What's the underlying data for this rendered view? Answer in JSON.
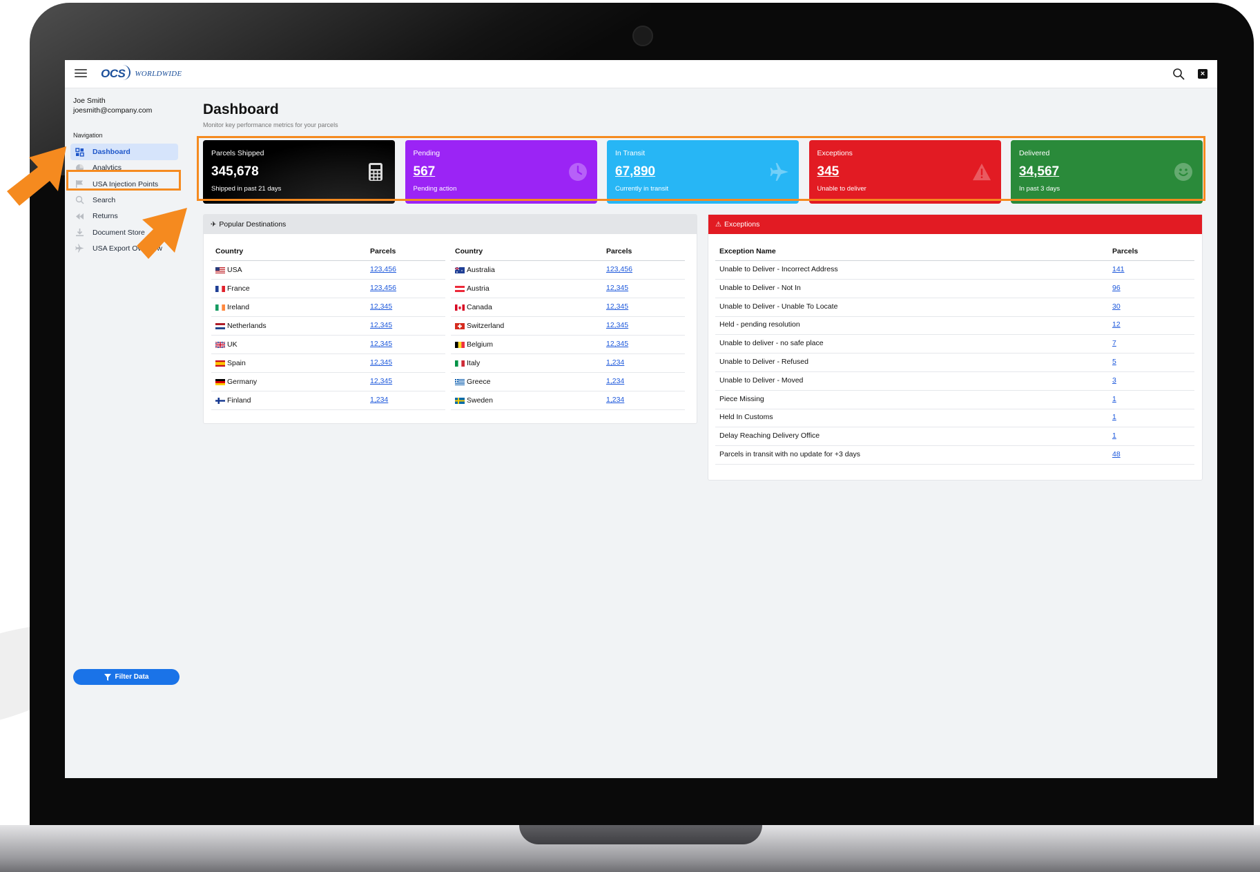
{
  "header": {
    "logo_mark": "OCS",
    "logo_word": "WORLDWIDE",
    "close_label": "×"
  },
  "user": {
    "name": "Joe Smith",
    "email": "joesmith@company.com"
  },
  "navigation": {
    "title": "Navigation",
    "items": [
      {
        "label": "Dashboard",
        "icon": "grid-icon",
        "active": true
      },
      {
        "label": "Analytics",
        "icon": "pie-chart-icon"
      },
      {
        "label": "USA Injection Points",
        "icon": "flag-icon"
      },
      {
        "label": "Search",
        "icon": "search-icon"
      },
      {
        "label": "Returns",
        "icon": "rewind-icon"
      },
      {
        "label": "Document Store",
        "icon": "download-icon"
      },
      {
        "label": "USA Export Overview",
        "icon": "plane-icon"
      }
    ],
    "filter_label": "Filter Data"
  },
  "page": {
    "title": "Dashboard",
    "subtitle": "Monitor key performance metrics for your parcels"
  },
  "cards": [
    {
      "label": "Parcels Shipped",
      "value": "345,678",
      "sub": "Shipped in past 21 days",
      "color": "#111111",
      "icon": "calculator-icon"
    },
    {
      "label": "Pending",
      "value": "567",
      "sub": "Pending action",
      "color": "#9b24f5",
      "icon": "clock-icon"
    },
    {
      "label": "In Transit",
      "value": "67,890",
      "sub": "Currently in transit",
      "color": "#27b6f5",
      "icon": "plane-icon"
    },
    {
      "label": "Exceptions",
      "value": "345",
      "sub": "Unable to deliver",
      "color": "#e21b23",
      "icon": "warning-icon"
    },
    {
      "label": "Delivered",
      "value": "34,567",
      "sub": "In past 3 days",
      "color": "#2a8a3a",
      "icon": "smiley-icon"
    }
  ],
  "destinations": {
    "title": "Popular Destinations",
    "headers": {
      "country": "Country",
      "parcels": "Parcels"
    },
    "left": [
      {
        "country": "USA",
        "parcels": "123,456",
        "flag": "usa"
      },
      {
        "country": "France",
        "parcels": "123,456",
        "flag": "france"
      },
      {
        "country": "Ireland",
        "parcels": "12,345",
        "flag": "ireland"
      },
      {
        "country": "Netherlands",
        "parcels": "12,345",
        "flag": "netherlands"
      },
      {
        "country": "UK",
        "parcels": "12,345",
        "flag": "uk"
      },
      {
        "country": "Spain",
        "parcels": "12,345",
        "flag": "spain"
      },
      {
        "country": "Germany",
        "parcels": "12,345",
        "flag": "germany"
      },
      {
        "country": "Finland",
        "parcels": "1,234",
        "flag": "finland"
      }
    ],
    "right": [
      {
        "country": "Australia",
        "parcels": "123,456",
        "flag": "australia"
      },
      {
        "country": "Austria",
        "parcels": "12,345",
        "flag": "austria"
      },
      {
        "country": "Canada",
        "parcels": "12,345",
        "flag": "canada"
      },
      {
        "country": "Switzerland",
        "parcels": "12,345",
        "flag": "switzerland"
      },
      {
        "country": "Belgium",
        "parcels": "12,345",
        "flag": "belgium"
      },
      {
        "country": "Italy",
        "parcels": "1,234",
        "flag": "italy"
      },
      {
        "country": "Greece",
        "parcels": "1,234",
        "flag": "greece"
      },
      {
        "country": "Sweden",
        "parcels": "1,234",
        "flag": "sweden"
      }
    ]
  },
  "exceptions": {
    "title": "Exceptions",
    "headers": {
      "name": "Exception Name",
      "parcels": "Parcels"
    },
    "rows": [
      {
        "name": "Unable to Deliver - Incorrect Address",
        "parcels": "141"
      },
      {
        "name": "Unable to Deliver - Not In",
        "parcels": "96"
      },
      {
        "name": "Unable to Deliver - Unable To Locate",
        "parcels": "30"
      },
      {
        "name": "Held - pending resolution",
        "parcels": "12"
      },
      {
        "name": "Unable to deliver - no safe place",
        "parcels": "7"
      },
      {
        "name": "Unable to Deliver - Refused",
        "parcels": "5"
      },
      {
        "name": "Unable to Deliver - Moved",
        "parcels": "3"
      },
      {
        "name": "Piece Missing",
        "parcels": "1"
      },
      {
        "name": "Held In Customs",
        "parcels": "1"
      },
      {
        "name": "Delay Reaching Delivery Office",
        "parcels": "1"
      },
      {
        "name": "Parcels in transit with no update for +3 days",
        "parcels": "48"
      }
    ]
  },
  "colors": {
    "accent": "#1a73e8",
    "highlight": "#f58a1f",
    "exceptions_header": "#e21b23"
  }
}
